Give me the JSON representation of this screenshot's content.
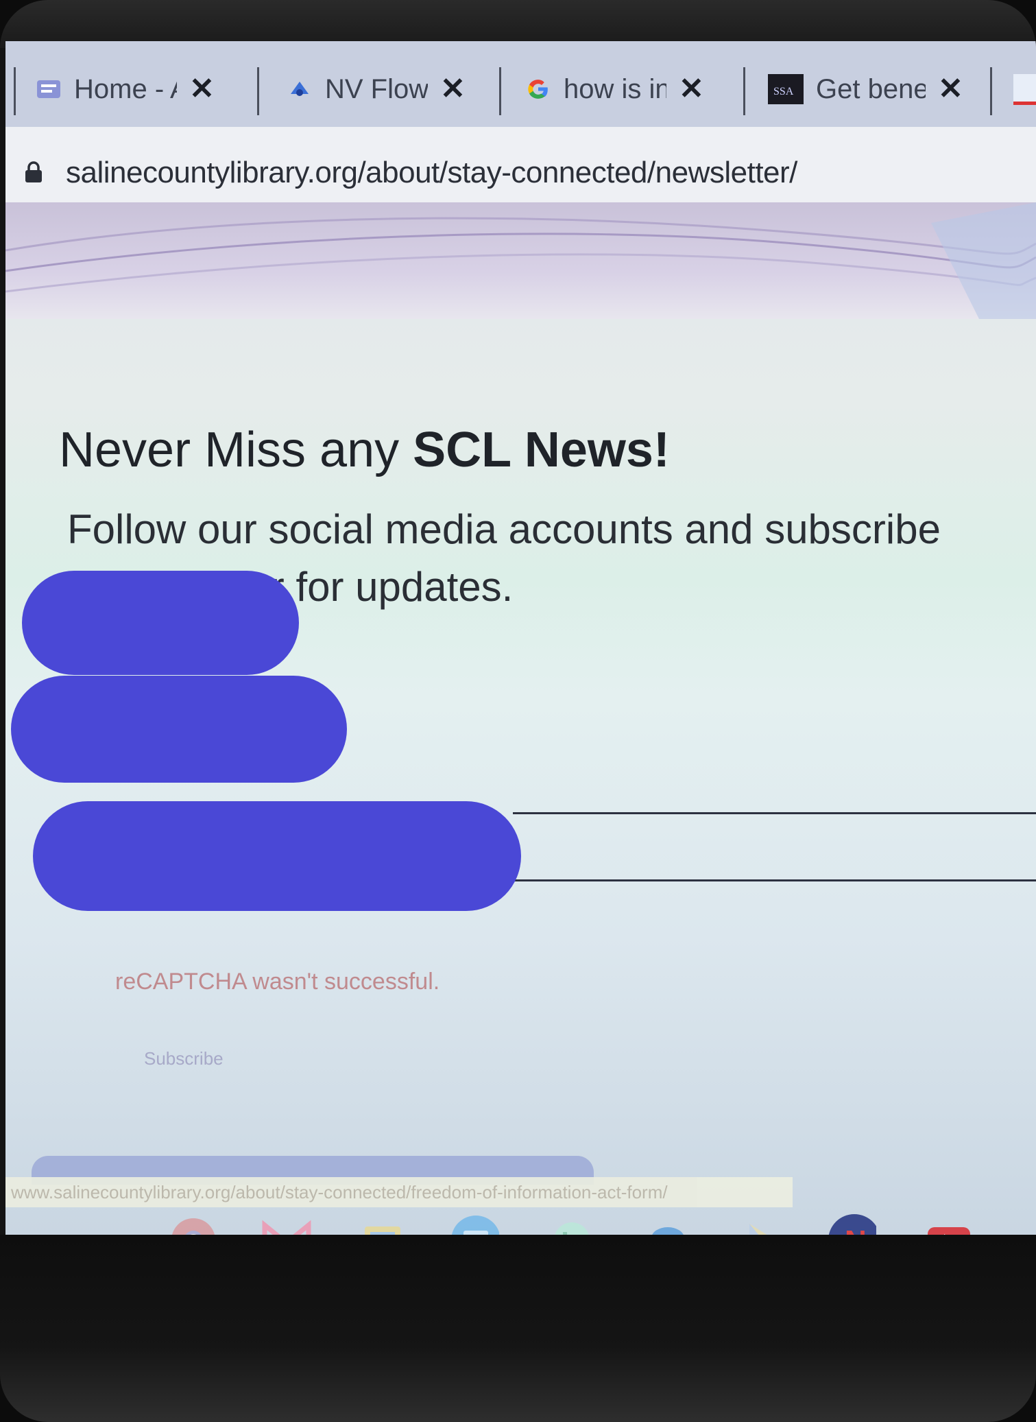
{
  "browser": {
    "tabs": [
      {
        "title": "Home - A",
        "icon": "library-favicon"
      },
      {
        "title": "NV Flow",
        "icon": "nv-flow-favicon"
      },
      {
        "title": "how is in",
        "icon": "google-icon"
      },
      {
        "title": "Get bene",
        "icon": "ssa-favicon"
      }
    ],
    "url": "salinecountylibrary.org/about/stay-connected/newsletter/"
  },
  "page": {
    "heading_prefix": "Never Miss any",
    "heading_emphasis": "SCL News!",
    "subtext": "Follow our social media accounts and subscribe eNewsletter for updates.",
    "recaptcha_error": "reCAPTCHA wasn't successful.",
    "subscribe_label": "Subscribe"
  },
  "status_url": "www.salinecountylibrary.org/about/stay-connected/freedom-of-information-act-form/",
  "shelf_apps": [
    "chrome-icon",
    "gmail-icon",
    "classroom-icon",
    "files-icon",
    "phone-icon",
    "messages-icon",
    "play-store-icon",
    "netflix-icon",
    "youtube-icon"
  ],
  "colors": {
    "redaction": "#4a48d6",
    "error_text": "#c08a8e"
  }
}
